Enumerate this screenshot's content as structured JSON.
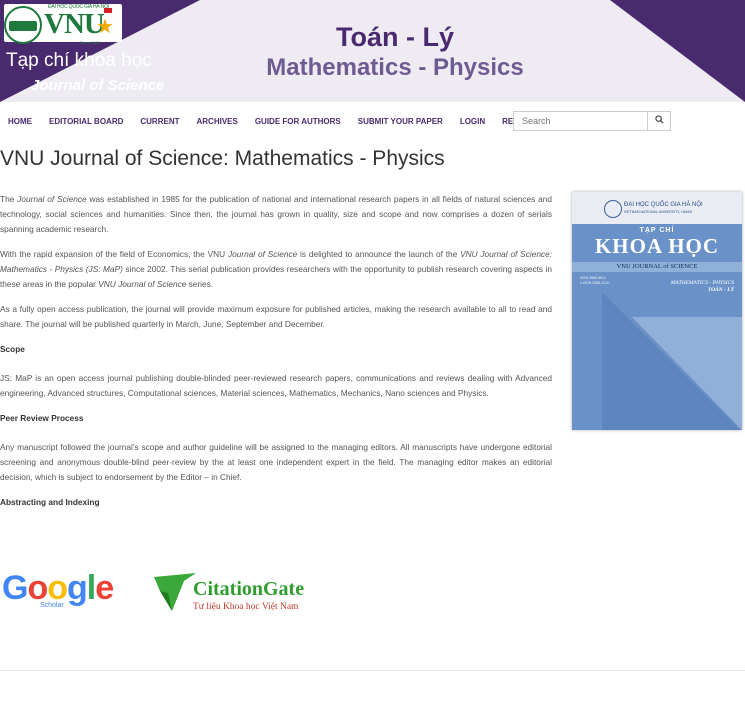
{
  "banner": {
    "logo_small_text": "ĐẠI HỌC QUỐC GIA HÀ NỘI",
    "logo_text": "VNU",
    "logo_since": "Since 1993",
    "title_vi": "Tạp chí khoa học",
    "title_en": "Journal of Science",
    "subject_vi": "Toán - Lý",
    "subject_en": "Mathematics - Physics"
  },
  "nav": {
    "items": [
      "HOME",
      "EDITORIAL BOARD",
      "CURRENT",
      "ARCHIVES",
      "GUIDE FOR AUTHORS",
      "SUBMIT YOUR PAPER",
      "LOGIN",
      "REGISTER"
    ]
  },
  "search": {
    "placeholder": "Search",
    "icon": "search-icon"
  },
  "page_title": "VNU Journal of Science: Mathematics - Physics",
  "paragraphs": {
    "p1_a": "The ",
    "p1_em": "Journal of Science",
    "p1_b": " was established in 1985 for the publication of national and international research papers in all fields of natural sciences and technology, social sciences and humanities. Since then, the journal has grown in quality, size and scope and now comprises a dozen of serials spanning academic research.",
    "p2_a": "With the rapid expansion of the field of Economics, the VNU ",
    "p2_em1": "Journal of Science",
    "p2_b": " is delighted to announce the launch of the ",
    "p2_em2": "VNU Journal of Science: Mathematics - Physics  (JS: MaP)",
    "p2_c": " since 2002. This serial publication provides researchers with the opportunity to publish research covering aspects in these areas in the popular ",
    "p2_em3": "VNU Journal of Science",
    "p2_d": " series.",
    "p3": "As a fully open access publication, the journal will provide maximum exposure for published articles, making the research available to all to read and share. The journal will be published quarterly in March, June, September and December.",
    "scope_heading": "Scope",
    "scope_text": "JS: MaP is an open access journal publishing double-blinded peer-reviewed research papers, communications and reviews dealing with Advanced engineering, Advanced structures, Computational sciences, Material sciences, Mathematics, Mechanics, Nano sciences and Physics.",
    "peer_heading": "Peer Review Process",
    "peer_text": "Any manuscript followed the journal’s scope and author guideline will be assigned to the managing editors. All manuscripts have undergone editorial screening and anonymous double-blind peer-review by the at least one independent expert in the field. The managing editor makes an editorial decision, which is subject to endorsement by the Editor – in Chief.",
    "index_heading": "Abstracting and Indexing"
  },
  "cover": {
    "university": "ĐẠI HỌC QUỐC GIA HÀ NỘI",
    "university_en": "VIETNAM NATIONAL UNIVERSITY, HANOI",
    "tap_chi": "TẠP CHÍ",
    "khoa_hoc": "KHOA HỌC",
    "band": "VNU JOURNAL of SCIENCE",
    "issn1": "ISSN 0866-8612",
    "issn2": "e-ISSN 2588-1124",
    "subject_en": "MATHEMATICS - PHYSICS",
    "subject_vi": "TOÁN - LÝ"
  },
  "indexing": {
    "google": {
      "g": "G",
      "o1": "o",
      "o2": "o",
      "g2": "g",
      "l": "l",
      "e": "e",
      "sub": "Scholar"
    },
    "citationgate": {
      "name": "CitationGate",
      "sub": "Tư liệu Khoa học Việt Nam"
    }
  },
  "colors": {
    "brand_purple": "#4a2a6e",
    "link_purple": "#4a2a6e",
    "vnu_green": "#1d7a3c",
    "cover_blue": "#6b92c8"
  }
}
